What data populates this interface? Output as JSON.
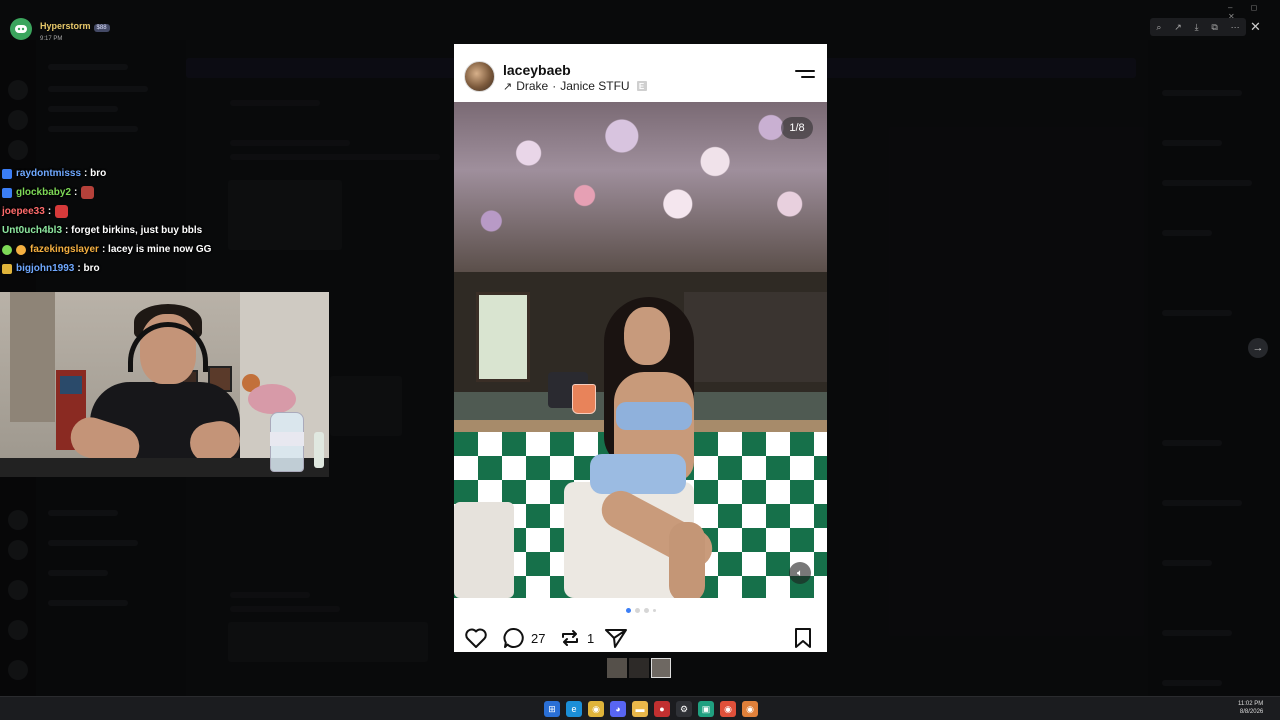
{
  "notification": {
    "name": "Hyperstorm",
    "badge": "$88",
    "time": "9:17 PM"
  },
  "chat": [
    {
      "user": "raydontmisss",
      "message": ": bro",
      "user_color": "#6fa8ff",
      "badge_color": "#3b7ef6"
    },
    {
      "user": "glockbaby2",
      "message": ":",
      "user_color": "#7ed957",
      "badge_color": "#3b7ef6",
      "emote": true
    },
    {
      "user": "joepee33",
      "message": ":",
      "user_color": "#ff6b6b",
      "badge_color": null,
      "emote": true
    },
    {
      "user": "Unt0uch4bl3",
      "message": ": forget birkins, just buy bbls",
      "user_color": "#8ee8a0",
      "badge_color": null
    },
    {
      "user": "fazekingslayer",
      "message": ": lacey is mine now GG",
      "user_color": "#f5b041",
      "badge_color": "#7ed957"
    },
    {
      "user": "bigjohn1993",
      "message": ": bro",
      "user_color": "#6fa8ff",
      "badge_color": "#e0b43a"
    }
  ],
  "post": {
    "username": "laceybaeb",
    "song_artist": "Drake",
    "song_separator": "·",
    "song_title": "Janice STFU",
    "explicit_label": "E",
    "image_counter": "1/8",
    "comment_count": "27",
    "repost_count": "1"
  },
  "icons": {
    "menu": "menu-icon",
    "like": "heart-icon",
    "comment": "comment-icon",
    "repost": "repost-icon",
    "share": "send-icon",
    "save": "bookmark-icon",
    "volume": "volume-icon"
  },
  "taskbar": {
    "time": "11:02 PM",
    "date": "8/8/2026"
  },
  "colors": {
    "accent": "#3b7ef6",
    "tile_green": "#16704a"
  }
}
